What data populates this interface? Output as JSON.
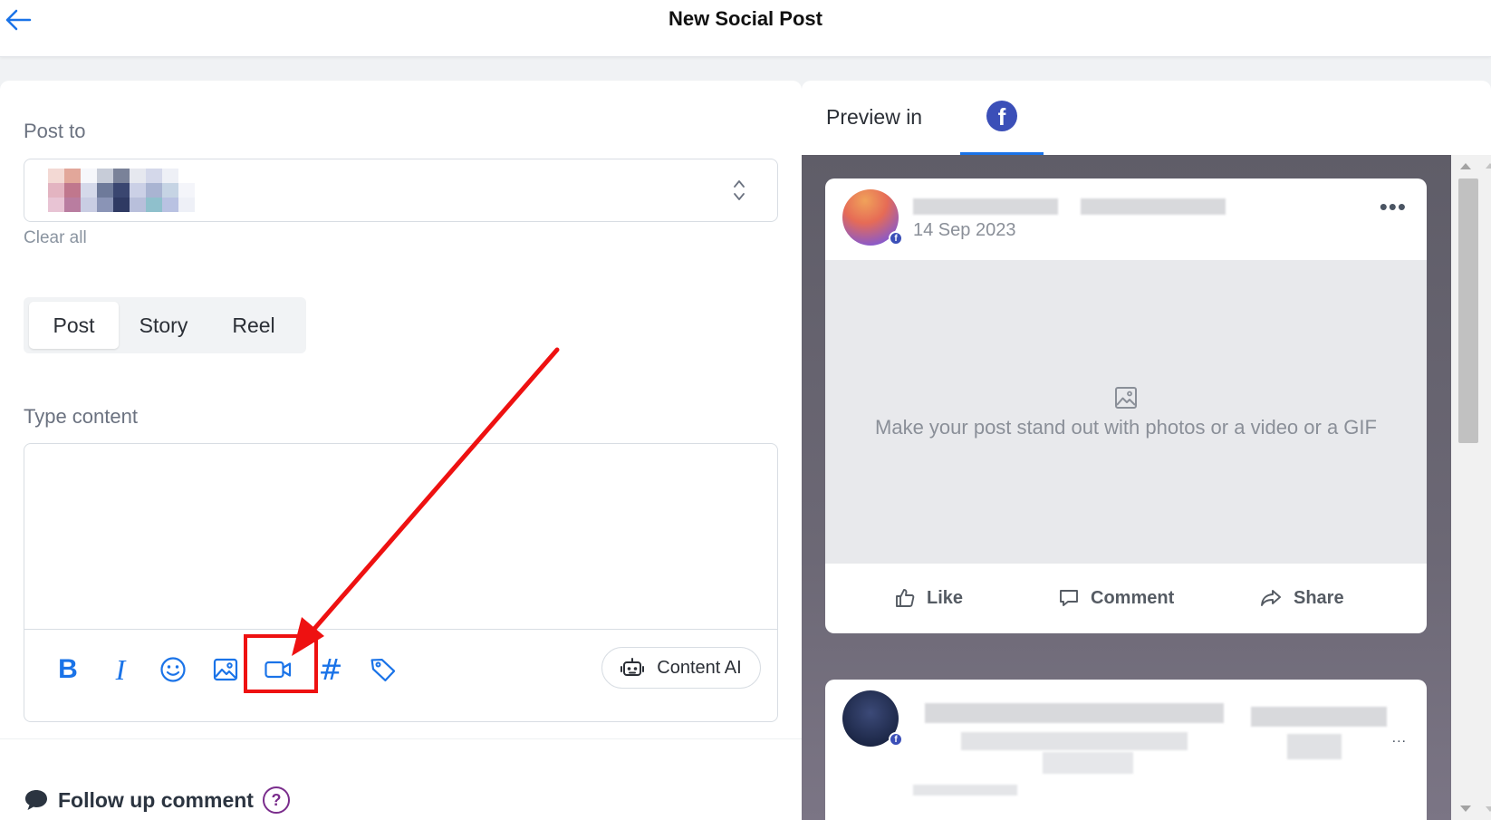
{
  "header": {
    "title": "New Social Post",
    "back_icon": "arrow-left-icon"
  },
  "composer": {
    "post_to_label": "Post to",
    "clear_all_label": "Clear all",
    "post_types": [
      "Post",
      "Story",
      "Reel"
    ],
    "active_post_type": "Post",
    "content_label": "Type content",
    "content_value": "",
    "toolbar_icons": [
      "bold-icon",
      "italic-icon",
      "emoji-icon",
      "image-icon",
      "video-icon",
      "hashtag-icon",
      "tag-icon"
    ],
    "toolbar_bold_glyph": "B",
    "toolbar_italic_glyph": "I",
    "toolbar_hash_glyph": "#",
    "content_ai_label": "Content AI",
    "follow_up_label": "Follow up comment",
    "help_glyph": "?"
  },
  "preview": {
    "label": "Preview in",
    "network": "facebook",
    "fb_glyph": "f",
    "post": {
      "date": "14 Sep 2023",
      "more_glyph": "•••",
      "media_placeholder": "Make your post stand out with photos or a video or a GIF",
      "actions": [
        "Like",
        "Comment",
        "Share"
      ]
    },
    "second_post_more_glyph": "..."
  },
  "colors": {
    "accent": "#1a73e8",
    "facebook": "#3b4fb8",
    "highlight": "#ee1111",
    "help": "#7a2d8c"
  }
}
